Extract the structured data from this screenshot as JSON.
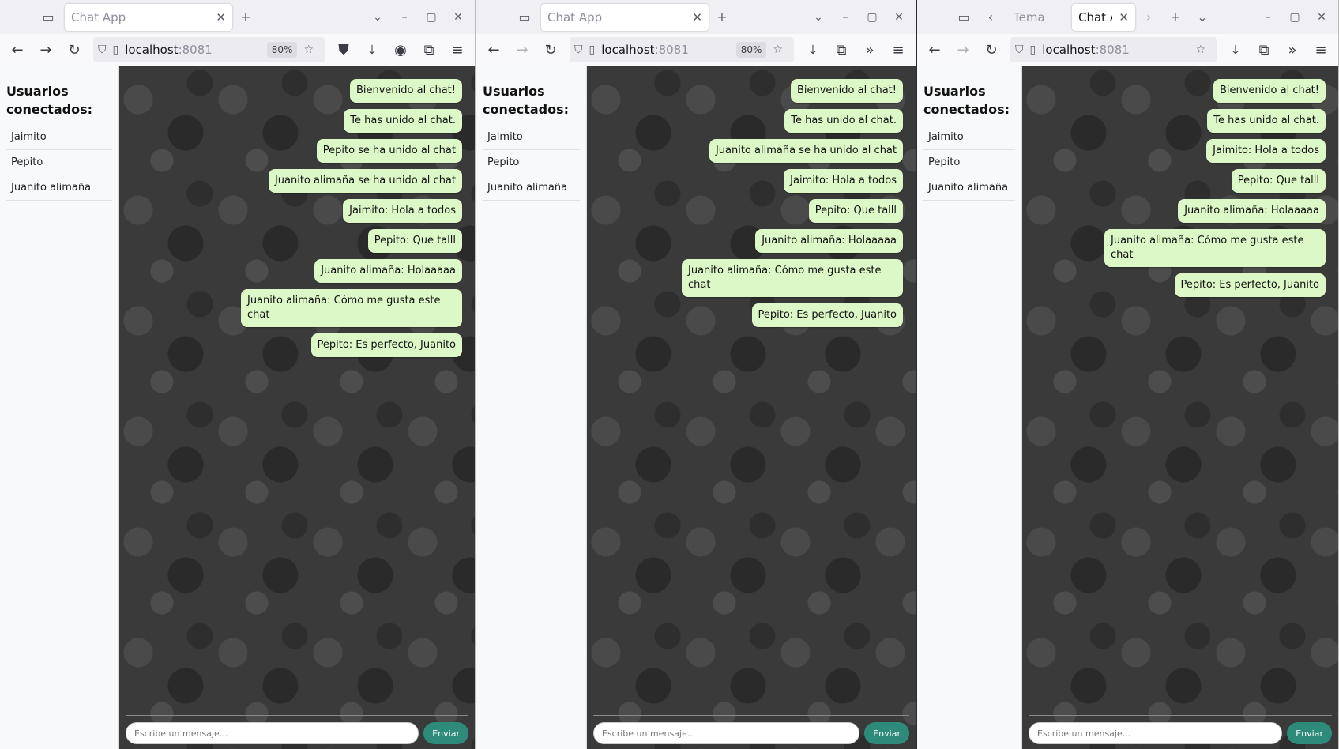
{
  "windows": [
    {
      "tabs": [
        {
          "title": "Chat App",
          "active": true
        }
      ],
      "url_host": "localhost",
      "url_port": ":8081",
      "zoom": "80%",
      "sidebar_title": "Usuarios conectados:",
      "users": [
        "Jaimito",
        "Pepito",
        "Juanito alimaña"
      ],
      "messages": [
        "Bienvenido al chat!",
        "Te has unido al chat.",
        "Pepito se ha unido al chat",
        "Juanito alimaña se ha unido al chat",
        "Jaimito: Hola a todos",
        "Pepito: Que talll",
        "Juanito alimaña: Holaaaaa",
        "Juanito alimaña: Cómo me gusta este chat",
        "Pepito: Es perfecto, Juanito"
      ],
      "input_placeholder": "Escribe un mensaje...",
      "send_label": "Enviar"
    },
    {
      "tabs": [
        {
          "title": "Chat App",
          "active": true
        }
      ],
      "url_host": "localhost",
      "url_port": ":8081",
      "zoom": "80%",
      "sidebar_title": "Usuarios conectados:",
      "users": [
        "Jaimito",
        "Pepito",
        "Juanito alimaña"
      ],
      "messages": [
        "Bienvenido al chat!",
        "Te has unido al chat.",
        "Juanito alimaña se ha unido al chat",
        "Jaimito: Hola a todos",
        "Pepito: Que talll",
        "Juanito alimaña: Holaaaaa",
        "Juanito alimaña: Cómo me gusta este chat",
        "Pepito: Es perfecto, Juanito"
      ],
      "input_placeholder": "Escribe un mensaje...",
      "send_label": "Enviar"
    },
    {
      "tabs": [
        {
          "title": "Tema",
          "active": false
        },
        {
          "title": "Chat A",
          "active": true
        }
      ],
      "url_host": "localhost",
      "url_port": ":8081",
      "zoom": "",
      "sidebar_title": "Usuarios conectados:",
      "users": [
        "Jaimito",
        "Pepito",
        "Juanito alimaña"
      ],
      "messages": [
        "Bienvenido al chat!",
        "Te has unido al chat.",
        "Jaimito: Hola a todos",
        "Pepito: Que talll",
        "Juanito alimaña: Holaaaaa",
        "Juanito alimaña: Cómo me gusta este chat",
        "Pepito: Es perfecto, Juanito"
      ],
      "input_placeholder": "Escribe un mensaje...",
      "send_label": "Enviar"
    }
  ]
}
